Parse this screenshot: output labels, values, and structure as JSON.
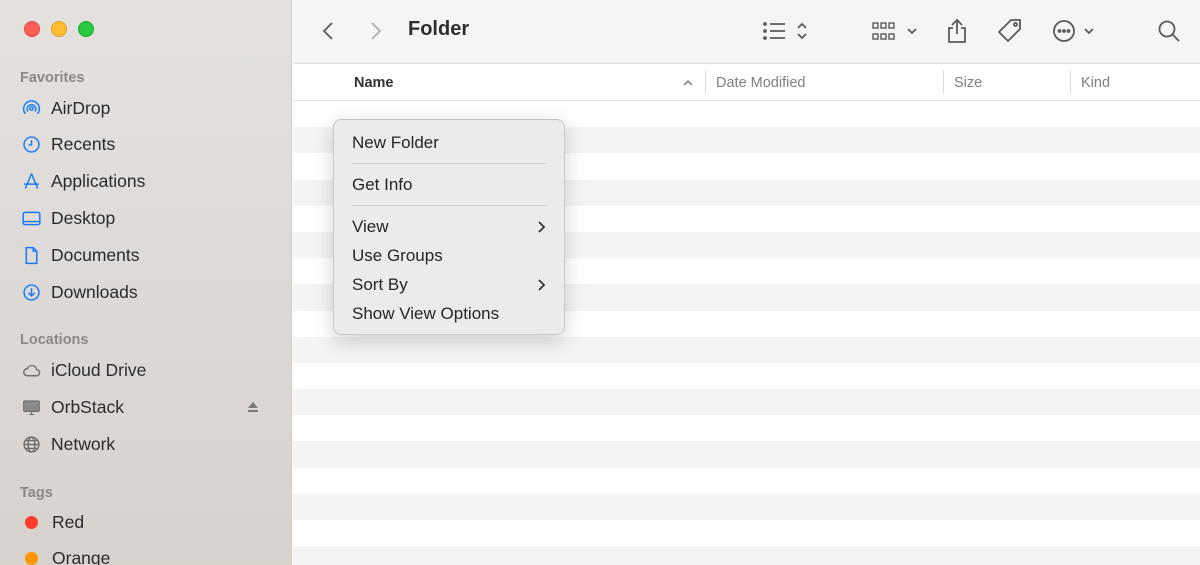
{
  "window": {
    "title": "Folder"
  },
  "sidebar": {
    "favorites_title": "Favorites",
    "favorites": [
      {
        "label": "AirDrop",
        "icon": "airdrop-icon"
      },
      {
        "label": "Recents",
        "icon": "clock-icon"
      },
      {
        "label": "Applications",
        "icon": "applications-icon"
      },
      {
        "label": "Desktop",
        "icon": "desktop-icon"
      },
      {
        "label": "Documents",
        "icon": "document-icon"
      },
      {
        "label": "Downloads",
        "icon": "download-icon"
      }
    ],
    "locations_title": "Locations",
    "locations": [
      {
        "label": "iCloud Drive",
        "icon": "cloud-icon"
      },
      {
        "label": "OrbStack",
        "icon": "display-icon",
        "eject": true
      },
      {
        "label": "Network",
        "icon": "globe-icon"
      }
    ],
    "tags_title": "Tags",
    "tags": [
      {
        "label": "Red",
        "color": "#ff3b30"
      },
      {
        "label": "Orange",
        "color": "#ff9500"
      }
    ]
  },
  "columns": {
    "name": "Name",
    "date_modified": "Date Modified",
    "size": "Size",
    "kind": "Kind"
  },
  "context_menu": {
    "new_folder": "New Folder",
    "get_info": "Get Info",
    "view": "View",
    "use_groups": "Use Groups",
    "sort_by": "Sort By",
    "show_view_options": "Show View Options"
  },
  "colors": {
    "accent": "#1a7cf5"
  }
}
